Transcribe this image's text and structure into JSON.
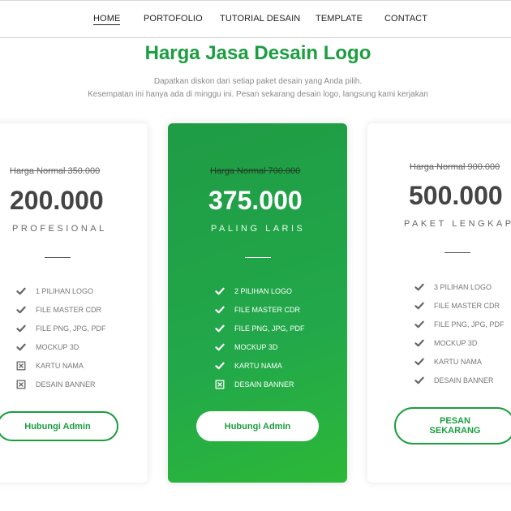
{
  "nav": {
    "items": [
      "HOME",
      "PORTOFOLIO",
      "TUTORIAL DESAIN",
      "TEMPLATE",
      "CONTACT"
    ],
    "active": "HOME"
  },
  "header": {
    "title": "Harga Jasa Desain Logo",
    "subtitle_line1": "Dapatkan diskon dari setiap paket desain yang Anda pilih.",
    "subtitle_line2": "Kesempatan ini hanya ada di minggu ini. Pesan sekarang desain logo, langsung kami kerjakan"
  },
  "plans": [
    {
      "old_price": "Harga Normal 350.000",
      "price": "200.000",
      "name": "PROFESIONAL",
      "features": [
        {
          "label": "1 PILIHAN LOGO",
          "included": true
        },
        {
          "label": "FILE MASTER CDR",
          "included": true
        },
        {
          "label": "FILE PNG, JPG, PDF",
          "included": true
        },
        {
          "label": "MOCKUP 3D",
          "included": true
        },
        {
          "label": "KARTU NAMA",
          "included": false
        },
        {
          "label": "DESAIN BANNER",
          "included": false
        }
      ],
      "button": "Hubungi Admin"
    },
    {
      "old_price": "Harga Normal 700.000",
      "price": "375.000",
      "name": "PALING LARIS",
      "features": [
        {
          "label": "2 PILIHAN LOGO",
          "included": true
        },
        {
          "label": "FILE MASTER CDR",
          "included": true
        },
        {
          "label": "FILE PNG, JPG, PDF",
          "included": true
        },
        {
          "label": "MOCKUP 3D",
          "included": true
        },
        {
          "label": "KARTU NAMA",
          "included": true
        },
        {
          "label": "DESAIN BANNER",
          "included": false
        }
      ],
      "button": "Hubungi Admin"
    },
    {
      "old_price": "Harga Normal 900.000",
      "price": "500.000",
      "name": "PAKET LENGKAP",
      "features": [
        {
          "label": "3 PILIHAN LOGO",
          "included": true
        },
        {
          "label": "FILE MASTER CDR",
          "included": true
        },
        {
          "label": "FILE PNG, JPG, PDF",
          "included": true
        },
        {
          "label": "MOCKUP 3D",
          "included": true
        },
        {
          "label": "KARTU NAMA",
          "included": true
        },
        {
          "label": "DESAIN BANNER",
          "included": true
        }
      ],
      "button": "PESAN\nSEKARANG"
    }
  ],
  "colors": {
    "accent": "#1a9e3f",
    "card_green_start": "#1f9b45",
    "card_green_end": "#2cb838"
  },
  "icons": {
    "included": "check-icon",
    "excluded": "x-box-icon"
  }
}
